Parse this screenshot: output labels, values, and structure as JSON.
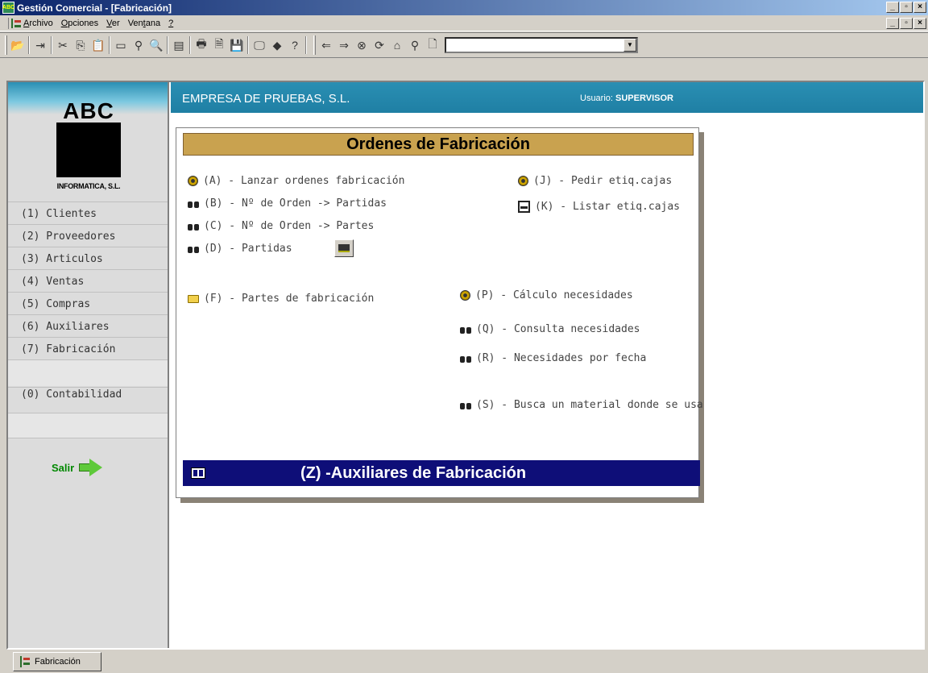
{
  "window": {
    "title": "Gestión Comercial - [Fabricación]",
    "app_icon": "abc-app-icon"
  },
  "menu": {
    "items": [
      {
        "label": "Archivo"
      },
      {
        "label": "Opciones"
      },
      {
        "label": "Ver"
      },
      {
        "label": "Ventana"
      },
      {
        "label": "?"
      }
    ]
  },
  "toolbar": {
    "combo_value": ""
  },
  "header": {
    "company": "EMPRESA DE PRUEBAS, S.L.",
    "user_label": "Usuario:",
    "user_name": "SUPERVISOR"
  },
  "logo": {
    "text": "ABC",
    "subtitle": "INFORMATICA, S.L."
  },
  "sidebar": {
    "items": [
      {
        "label": "(1) Clientes"
      },
      {
        "label": "(2) Proveedores"
      },
      {
        "label": "(3) Articulos"
      },
      {
        "label": "(4) Ventas"
      },
      {
        "label": "(5) Compras"
      },
      {
        "label": "(6) Auxiliares"
      },
      {
        "label": "(7) Fabricación"
      },
      {
        "label": "(0) Contabilidad"
      }
    ],
    "exit_label": "Salir"
  },
  "panel": {
    "title": "Ordenes de Fabricación",
    "options": {
      "a": "(A) - Lanzar ordenes fabricación",
      "b": "(B) - Nº de Orden -> Partidas",
      "c": "(C) - Nº de Orden -> Partes",
      "d": "(D) - Partidas",
      "f": "(F) - Partes de fabricación",
      "j": "(J) - Pedir etiq.cajas",
      "k": "(K) - Listar etiq.cajas",
      "p": "(P) - Cálculo necesidades",
      "q": "(Q) - Consulta necesidades",
      "r": "(R) - Necesidades por fecha",
      "s": "(S) - Busca un material donde se usa"
    },
    "z_bar": "(Z) -Auxiliares de Fabricación"
  },
  "taskbar": {
    "tab_label": "Fabricación"
  },
  "colors": {
    "title_gradient_start": "#0a246a",
    "header_teal": "#2a8fb3",
    "panel_title_gold": "#c9a24f",
    "z_bar_navy": "#0e0e78",
    "exit_green": "#5ec93a"
  }
}
